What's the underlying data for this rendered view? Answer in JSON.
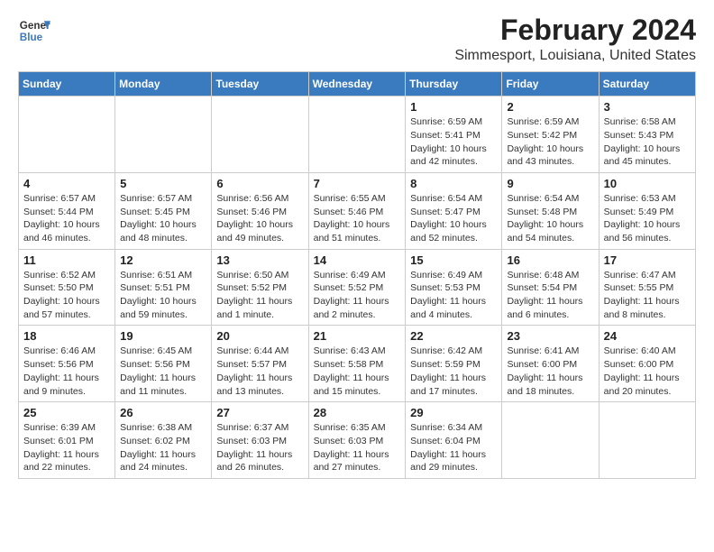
{
  "logo": {
    "line1": "General",
    "line2": "Blue"
  },
  "title": "February 2024",
  "subtitle": "Simmesport, Louisiana, United States",
  "days_of_week": [
    "Sunday",
    "Monday",
    "Tuesday",
    "Wednesday",
    "Thursday",
    "Friday",
    "Saturday"
  ],
  "weeks": [
    [
      {
        "day": "",
        "info": ""
      },
      {
        "day": "",
        "info": ""
      },
      {
        "day": "",
        "info": ""
      },
      {
        "day": "",
        "info": ""
      },
      {
        "day": "1",
        "info": "Sunrise: 6:59 AM\nSunset: 5:41 PM\nDaylight: 10 hours\nand 42 minutes."
      },
      {
        "day": "2",
        "info": "Sunrise: 6:59 AM\nSunset: 5:42 PM\nDaylight: 10 hours\nand 43 minutes."
      },
      {
        "day": "3",
        "info": "Sunrise: 6:58 AM\nSunset: 5:43 PM\nDaylight: 10 hours\nand 45 minutes."
      }
    ],
    [
      {
        "day": "4",
        "info": "Sunrise: 6:57 AM\nSunset: 5:44 PM\nDaylight: 10 hours\nand 46 minutes."
      },
      {
        "day": "5",
        "info": "Sunrise: 6:57 AM\nSunset: 5:45 PM\nDaylight: 10 hours\nand 48 minutes."
      },
      {
        "day": "6",
        "info": "Sunrise: 6:56 AM\nSunset: 5:46 PM\nDaylight: 10 hours\nand 49 minutes."
      },
      {
        "day": "7",
        "info": "Sunrise: 6:55 AM\nSunset: 5:46 PM\nDaylight: 10 hours\nand 51 minutes."
      },
      {
        "day": "8",
        "info": "Sunrise: 6:54 AM\nSunset: 5:47 PM\nDaylight: 10 hours\nand 52 minutes."
      },
      {
        "day": "9",
        "info": "Sunrise: 6:54 AM\nSunset: 5:48 PM\nDaylight: 10 hours\nand 54 minutes."
      },
      {
        "day": "10",
        "info": "Sunrise: 6:53 AM\nSunset: 5:49 PM\nDaylight: 10 hours\nand 56 minutes."
      }
    ],
    [
      {
        "day": "11",
        "info": "Sunrise: 6:52 AM\nSunset: 5:50 PM\nDaylight: 10 hours\nand 57 minutes."
      },
      {
        "day": "12",
        "info": "Sunrise: 6:51 AM\nSunset: 5:51 PM\nDaylight: 10 hours\nand 59 minutes."
      },
      {
        "day": "13",
        "info": "Sunrise: 6:50 AM\nSunset: 5:52 PM\nDaylight: 11 hours\nand 1 minute."
      },
      {
        "day": "14",
        "info": "Sunrise: 6:49 AM\nSunset: 5:52 PM\nDaylight: 11 hours\nand 2 minutes."
      },
      {
        "day": "15",
        "info": "Sunrise: 6:49 AM\nSunset: 5:53 PM\nDaylight: 11 hours\nand 4 minutes."
      },
      {
        "day": "16",
        "info": "Sunrise: 6:48 AM\nSunset: 5:54 PM\nDaylight: 11 hours\nand 6 minutes."
      },
      {
        "day": "17",
        "info": "Sunrise: 6:47 AM\nSunset: 5:55 PM\nDaylight: 11 hours\nand 8 minutes."
      }
    ],
    [
      {
        "day": "18",
        "info": "Sunrise: 6:46 AM\nSunset: 5:56 PM\nDaylight: 11 hours\nand 9 minutes."
      },
      {
        "day": "19",
        "info": "Sunrise: 6:45 AM\nSunset: 5:56 PM\nDaylight: 11 hours\nand 11 minutes."
      },
      {
        "day": "20",
        "info": "Sunrise: 6:44 AM\nSunset: 5:57 PM\nDaylight: 11 hours\nand 13 minutes."
      },
      {
        "day": "21",
        "info": "Sunrise: 6:43 AM\nSunset: 5:58 PM\nDaylight: 11 hours\nand 15 minutes."
      },
      {
        "day": "22",
        "info": "Sunrise: 6:42 AM\nSunset: 5:59 PM\nDaylight: 11 hours\nand 17 minutes."
      },
      {
        "day": "23",
        "info": "Sunrise: 6:41 AM\nSunset: 6:00 PM\nDaylight: 11 hours\nand 18 minutes."
      },
      {
        "day": "24",
        "info": "Sunrise: 6:40 AM\nSunset: 6:00 PM\nDaylight: 11 hours\nand 20 minutes."
      }
    ],
    [
      {
        "day": "25",
        "info": "Sunrise: 6:39 AM\nSunset: 6:01 PM\nDaylight: 11 hours\nand 22 minutes."
      },
      {
        "day": "26",
        "info": "Sunrise: 6:38 AM\nSunset: 6:02 PM\nDaylight: 11 hours\nand 24 minutes."
      },
      {
        "day": "27",
        "info": "Sunrise: 6:37 AM\nSunset: 6:03 PM\nDaylight: 11 hours\nand 26 minutes."
      },
      {
        "day": "28",
        "info": "Sunrise: 6:35 AM\nSunset: 6:03 PM\nDaylight: 11 hours\nand 27 minutes."
      },
      {
        "day": "29",
        "info": "Sunrise: 6:34 AM\nSunset: 6:04 PM\nDaylight: 11 hours\nand 29 minutes."
      },
      {
        "day": "",
        "info": ""
      },
      {
        "day": "",
        "info": ""
      }
    ]
  ]
}
